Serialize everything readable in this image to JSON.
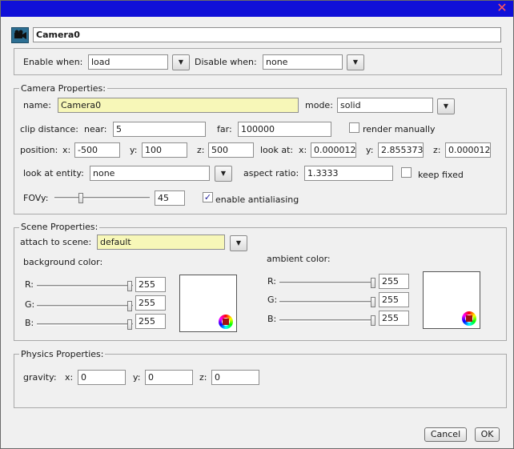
{
  "titlebar": {
    "close_glyph": "✕"
  },
  "object": {
    "icon": "camera-icon",
    "name": "Camera0"
  },
  "enable": {
    "enable_label": "Enable when:",
    "enable_value": "load",
    "disable_label": "Disable when:",
    "disable_value": "none"
  },
  "camera": {
    "legend": "Camera Properties:",
    "name_label": "name:",
    "name_value": "Camera0",
    "mode_label": "mode:",
    "mode_value": "solid",
    "clip_label": "clip distance:",
    "near_label": "near:",
    "near_value": "5",
    "far_label": "far:",
    "far_value": "100000",
    "render_manually_label": "render manually",
    "position_label": "position:",
    "pos_x_label": "x:",
    "pos_x": "-500",
    "pos_y_label": "y:",
    "pos_y": "100",
    "pos_z_label": "z:",
    "pos_z": "500",
    "lookat_label": "look at:",
    "look_x_label": "x:",
    "look_x": "0.000012",
    "look_y_label": "y:",
    "look_y": "2.855373",
    "look_z_label": "z:",
    "look_z": "0.000012",
    "look_entity_label": "look at entity:",
    "look_entity_value": "none",
    "aspect_label": "aspect ratio:",
    "aspect_value": "1.3333",
    "keep_fixed_label": "keep fixed",
    "fovy_label": "FOVy:",
    "fovy_value": "45",
    "antialias_label": "enable antialiasing"
  },
  "scene": {
    "legend": "Scene Properties:",
    "attach_label": "attach to scene:",
    "attach_value": "default",
    "bg_label": "background color:",
    "ambient_label": "ambient color:",
    "r_label": "R:",
    "g_label": "G:",
    "b_label": "B:",
    "bg_r": "255",
    "bg_g": "255",
    "bg_b": "255",
    "amb_r": "255",
    "amb_g": "255",
    "amb_b": "255"
  },
  "physics": {
    "legend": "Physics Properties:",
    "gravity_label": "gravity:",
    "x_label": "x:",
    "x_value": "0",
    "y_label": "y:",
    "y_value": "0",
    "z_label": "z:",
    "z_value": "0"
  },
  "buttons": {
    "cancel": "Cancel",
    "ok": "OK"
  },
  "dropdown_glyph": "▼",
  "check_glyph": "✓"
}
